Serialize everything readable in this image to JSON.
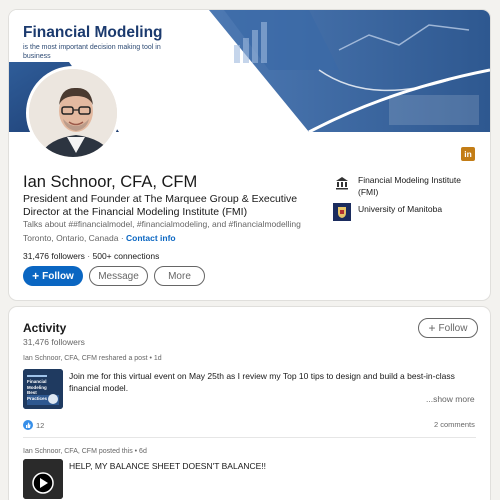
{
  "banner": {
    "title": "Financial Modeling",
    "subtitle": "is the most important decision making tool in business"
  },
  "profile": {
    "name": "Ian Schnoor, CFA, CFM",
    "headline": "President and Founder at The Marquee Group & Executive Director at the Financial Modeling Institute (FMI)",
    "talks_about": "Talks about ##financialmodel, #financialmodeling, and #financialmodelling",
    "location": "Toronto, Ontario, Canada",
    "contact_info": "Contact info",
    "followers": "31,476 followers",
    "connections": "500+ connections",
    "separator": " · "
  },
  "actions": {
    "follow": "Follow",
    "message": "Message",
    "more": "More"
  },
  "orgs": [
    {
      "name": "Financial Modeling Institute (FMI)"
    },
    {
      "name": "University of Manitoba"
    }
  ],
  "social_badge": "in",
  "activity": {
    "title": "Activity",
    "followers": "31,476 followers",
    "follow": "Follow",
    "posts": [
      {
        "author": "Ian Schnoor, CFA, CFM",
        "action": " reshared a post • 1d",
        "text": "Join me for this virtual event on May 25th as I review my Top 10 tips to design and build a best-in-class financial model.",
        "show_more": "...show more",
        "likes": "12",
        "comments": "2 comments",
        "thumb_title": "Financial Modeling Best Practices"
      },
      {
        "author": "Ian Schnoor, CFA, CFM",
        "action": " posted this • 6d",
        "text": "HELP, MY BALANCE SHEET DOESN'T BALANCE!!"
      }
    ]
  },
  "colors": {
    "accent": "#0a66c2",
    "banner_navy": "#1b3a6e",
    "linkedin_badge": "#c37d16"
  }
}
